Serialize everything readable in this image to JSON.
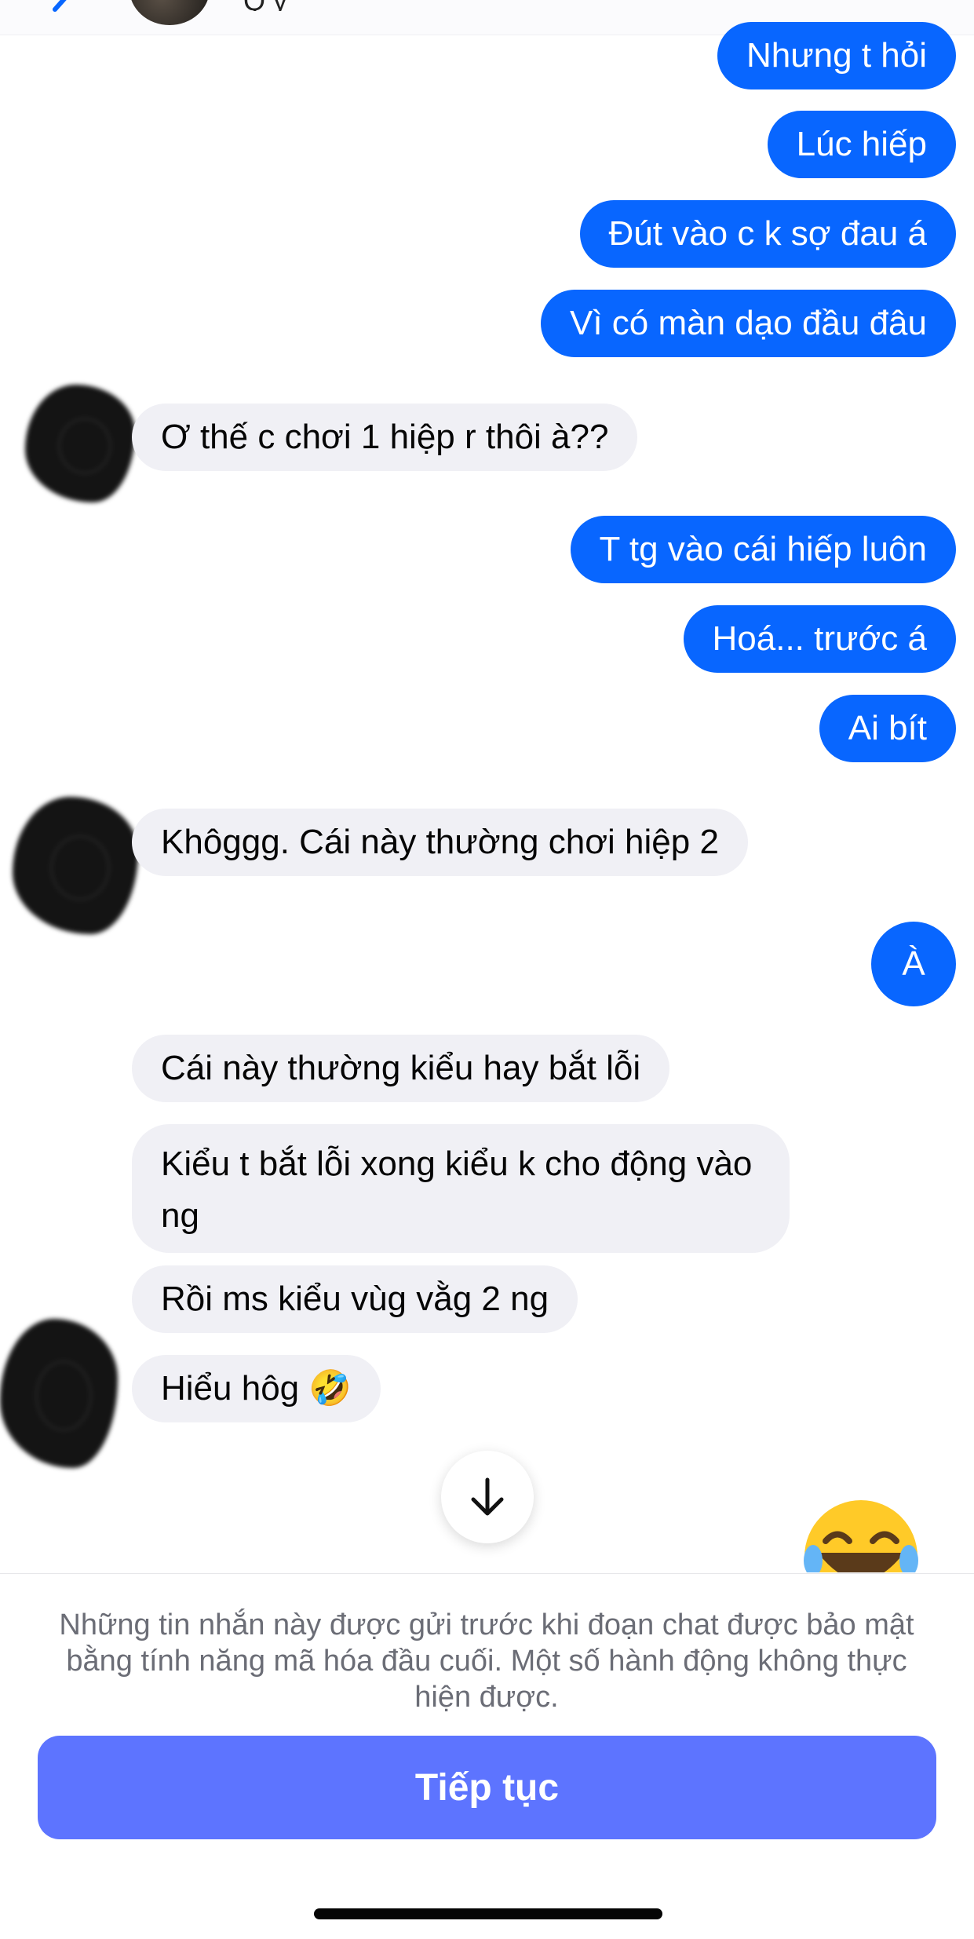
{
  "header": {
    "back_icon": "chevron-left-icon",
    "name_fragment": "Q y"
  },
  "messages": [
    {
      "id": "m1",
      "direction": "outgoing",
      "text": "Nhưng t hỏi"
    },
    {
      "id": "m2",
      "direction": "outgoing",
      "text": "Lúc hiếp"
    },
    {
      "id": "m3",
      "direction": "outgoing",
      "text": "Đút vào c k sợ đau á"
    },
    {
      "id": "m4",
      "direction": "outgoing",
      "text": "Vì có màn dạo đầu đâu"
    },
    {
      "id": "m5",
      "direction": "incoming",
      "text": "Ơ thế c chơi 1 hiệp r thôi à??"
    },
    {
      "id": "m6",
      "direction": "outgoing",
      "text": "T tg vào cái hiếp luôn"
    },
    {
      "id": "m7",
      "direction": "outgoing",
      "text": "Hoá... trước á"
    },
    {
      "id": "m8",
      "direction": "outgoing",
      "text": "Ai bít"
    },
    {
      "id": "m9",
      "direction": "incoming",
      "text": "Khôggg. Cái này thường chơi hiệp 2"
    },
    {
      "id": "m10",
      "direction": "outgoing",
      "text": "À"
    },
    {
      "id": "m11",
      "direction": "incoming",
      "text": "Cái này thường kiểu hay bắt lỗi"
    },
    {
      "id": "m12",
      "direction": "incoming",
      "text": "Kiểu t bắt lỗi xong kiểu k cho động vào ng"
    },
    {
      "id": "m13",
      "direction": "incoming",
      "text": "Rồi ms kiểu vùg vằg 2 ng"
    },
    {
      "id": "m14",
      "direction": "incoming",
      "text": "Hiểu hôg 🤣"
    }
  ],
  "scroll_button": {
    "icon": "arrow-down-icon"
  },
  "reaction_emoji": "😂",
  "footer": {
    "notice": "Những tin nhắn này được gửi trước khi đoạn chat được bảo mật bằng tính năng mã hóa đầu cuối. Một số hành động không thực hiện được.",
    "continue_label": "Tiếp tục"
  },
  "colors": {
    "outgoing_bubble": "#0866ff",
    "incoming_bubble": "#f0f0f5",
    "continue_button": "#5d74ff",
    "notice_text": "#6b6d76"
  }
}
